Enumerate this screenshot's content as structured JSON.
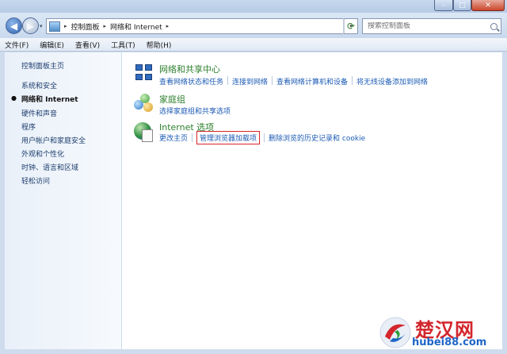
{
  "window": {
    "controls": {
      "minimize": "–",
      "maximize": "□",
      "close": "✕"
    }
  },
  "address": {
    "crumbs": [
      "控制面板",
      "网络和 Internet"
    ],
    "separator": "▸",
    "dropdown": "▾"
  },
  "search": {
    "placeholder": "搜索控制面板"
  },
  "menubar": {
    "items": [
      "文件(F)",
      "编辑(E)",
      "查看(V)",
      "工具(T)",
      "帮助(H)"
    ]
  },
  "sidebar": {
    "items": [
      {
        "label": "控制面板主页"
      },
      {
        "label": "系统和安全"
      },
      {
        "label": "网络和 Internet",
        "active": true
      },
      {
        "label": "硬件和声音"
      },
      {
        "label": "程序"
      },
      {
        "label": "用户帐户和家庭安全"
      },
      {
        "label": "外观和个性化"
      },
      {
        "label": "时钟、语言和区域"
      },
      {
        "label": "轻松访问"
      }
    ],
    "active_bullet": "●"
  },
  "categories": [
    {
      "title": "网络和共享中心",
      "icon": "network-sharing-icon",
      "links": [
        "查看网络状态和任务",
        "连接到网络",
        "查看网络计算机和设备",
        "将无线设备添加到网络"
      ]
    },
    {
      "title": "家庭组",
      "icon": "homegroup-icon",
      "links": [
        "选择家庭组和共享选项"
      ]
    },
    {
      "title": "Internet 选项",
      "icon": "internet-options-icon",
      "links": [
        "更改主页",
        "管理浏览器加载项",
        "删除浏览的历史记录和 cookie"
      ],
      "highlighted_link_index": 1
    }
  ],
  "colors": {
    "category_title": "#2c7f2c",
    "link": "#1c5bb5",
    "highlight_box": "#d8232a"
  },
  "watermark": {
    "brand": "楚汉网",
    "url": "hubei88.com"
  }
}
